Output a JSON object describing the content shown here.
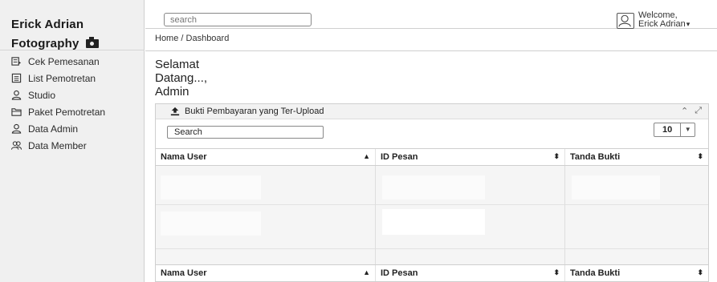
{
  "brand": {
    "line1": "Erick Adrian",
    "line2": "Fotography"
  },
  "sidebar": {
    "items": [
      {
        "label": "Cek Pemesanan",
        "icon": "clipboard-check-icon"
      },
      {
        "label": "List Pemotretan",
        "icon": "list-icon"
      },
      {
        "label": "Studio",
        "icon": "user-icon"
      },
      {
        "label": "Paket Pemotretan",
        "icon": "folder-icon"
      },
      {
        "label": "Data Admin",
        "icon": "user-icon"
      },
      {
        "label": "Data Member",
        "icon": "users-icon"
      }
    ]
  },
  "header": {
    "search_placeholder": "search",
    "welcome_line1": "Welcome,",
    "welcome_line2": "Erick Adrian"
  },
  "breadcrumb": "Home / Dashboard",
  "greeting": {
    "line1": "Selamat",
    "line2": "Datang...,",
    "line3": "Admin"
  },
  "card": {
    "title": "Bukti Pembayaran yang Ter-Upload",
    "search_label": "Search",
    "page_size": "10"
  },
  "table": {
    "columns": [
      "Nama User",
      "ID Pesan",
      "Tanda Bukti"
    ],
    "rows": []
  }
}
